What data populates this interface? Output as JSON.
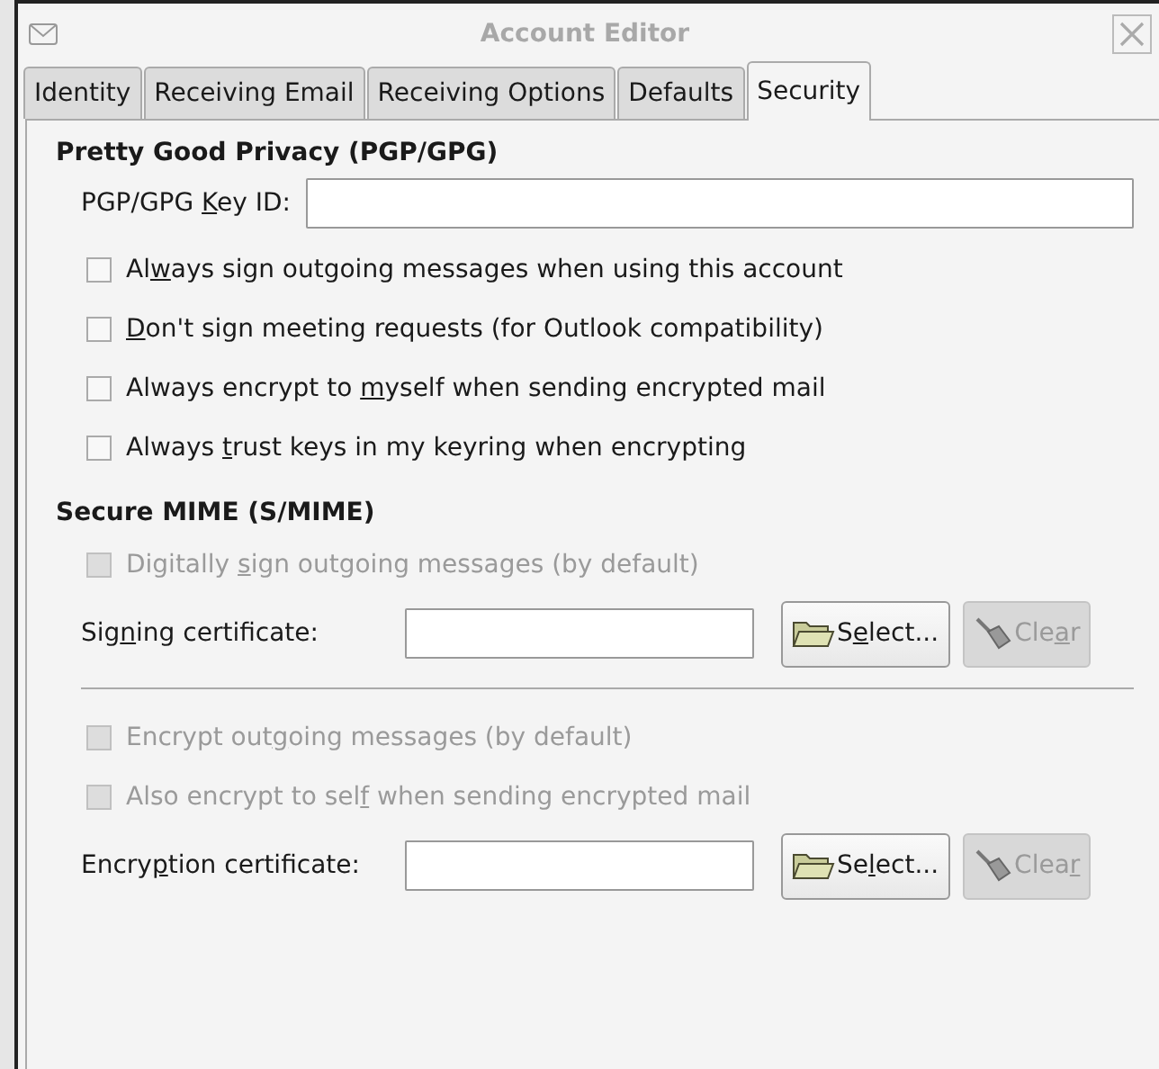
{
  "window": {
    "title": "Account Editor"
  },
  "tabs": [
    {
      "label": "Identity",
      "selected": false
    },
    {
      "label": "Receiving Email",
      "selected": false
    },
    {
      "label": "Receiving Options",
      "selected": false
    },
    {
      "label": "Defaults",
      "selected": false
    },
    {
      "label": "Security",
      "selected": true
    }
  ],
  "pgp": {
    "heading": "Pretty Good Privacy (PGP/GPG)",
    "key_id": {
      "label": {
        "pre": "PGP/GPG ",
        "key": "K",
        "post": "ey ID:"
      }
    },
    "options": [
      {
        "label": {
          "pre": "Al",
          "key": "w",
          "post": "ays sign outgoing messages when using this account"
        },
        "checked": false,
        "disabled": false
      },
      {
        "label": {
          "key": "D",
          "post": "on't sign meeting requests (for Outlook compatibility)"
        },
        "checked": false,
        "disabled": false
      },
      {
        "label": {
          "pre": "Always encrypt to ",
          "key": "m",
          "post": "yself when sending encrypted mail"
        },
        "checked": false,
        "disabled": false
      },
      {
        "label": {
          "pre": "Always ",
          "key": "t",
          "post": "rust keys in my keyring when encrypting"
        },
        "checked": false,
        "disabled": false
      }
    ]
  },
  "smime": {
    "heading": "Secure MIME (S/MIME)",
    "sign_options": [
      {
        "label": {
          "pre": "Digitally ",
          "key": "s",
          "post": "ign outgoing messages (by default)"
        },
        "checked": false,
        "disabled": true
      }
    ],
    "signing_certificate": {
      "label": {
        "pre": "Sig",
        "key": "n",
        "post": "ing certificate:"
      },
      "select_button": {
        "label": {
          "pre": "S",
          "key": "e",
          "post": "lect..."
        },
        "disabled": false
      },
      "clear_button": {
        "label": {
          "pre": "Cle",
          "key": "a",
          "post": "r"
        },
        "disabled": true
      }
    },
    "encrypt_options": [
      {
        "label": {
          "pre": "Encrypt out",
          "key": "g",
          "post": "oing messages (by default)"
        },
        "checked": false,
        "disabled": true
      },
      {
        "label": {
          "pre": "Also encrypt to sel",
          "key": "f",
          "post": " when sending encrypted mail"
        },
        "checked": false,
        "disabled": true
      }
    ],
    "encryption_certificate": {
      "label": {
        "pre": "Encry",
        "key": "p",
        "post": "tion certificate:"
      },
      "select_button": {
        "label": {
          "pre": "Se",
          "key": "l",
          "post": "ect..."
        },
        "disabled": false
      },
      "clear_button": {
        "label": {
          "pre": "Clea",
          "key": "r"
        },
        "disabled": true
      }
    }
  }
}
